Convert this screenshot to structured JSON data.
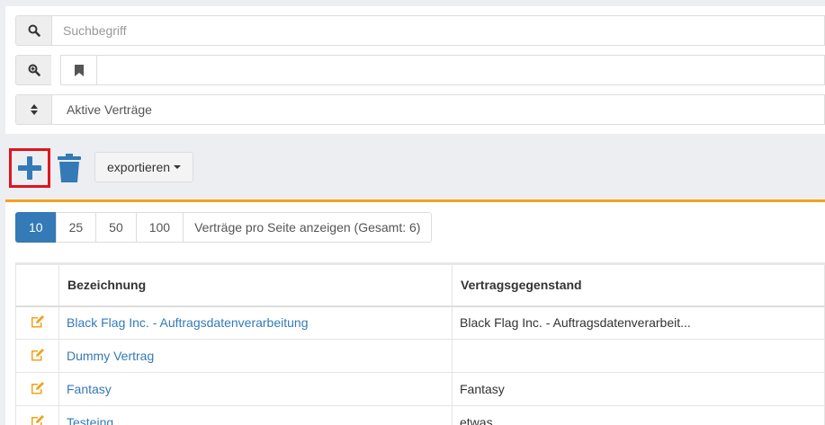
{
  "filters": {
    "search_placeholder": "Suchbegriff",
    "bookmark_value": "",
    "status_value": "Aktive Verträge"
  },
  "toolbar": {
    "add_icon": "plus-icon",
    "delete_icon": "trash-icon",
    "export_label": "exportieren"
  },
  "pager": {
    "sizes": [
      "10",
      "25",
      "50",
      "100"
    ],
    "active": "10",
    "info": "Verträge pro Seite anzeigen (Gesamt: 6)"
  },
  "table": {
    "columns": [
      "",
      "Bezeichnung",
      "Vertragsgegenstand"
    ],
    "rows": [
      {
        "icon": "edit-icon",
        "bezeichnung": "Black Flag Inc. - Auftragsdatenverarbeitung",
        "gegenstand": "Black Flag Inc. - Auftragsdatenverarbeit..."
      },
      {
        "icon": "edit-icon",
        "bezeichnung": "Dummy Vertrag",
        "gegenstand": ""
      },
      {
        "icon": "edit-icon",
        "bezeichnung": "Fantasy",
        "gegenstand": "Fantasy"
      },
      {
        "icon": "edit-icon",
        "bezeichnung": "Testeing",
        "gegenstand": "etwas"
      }
    ]
  },
  "colors": {
    "accent": "#337ab7",
    "highlight_border": "#e0141e",
    "edit_icon": "#f0a31c",
    "content_top_border": "#f0a31c"
  }
}
